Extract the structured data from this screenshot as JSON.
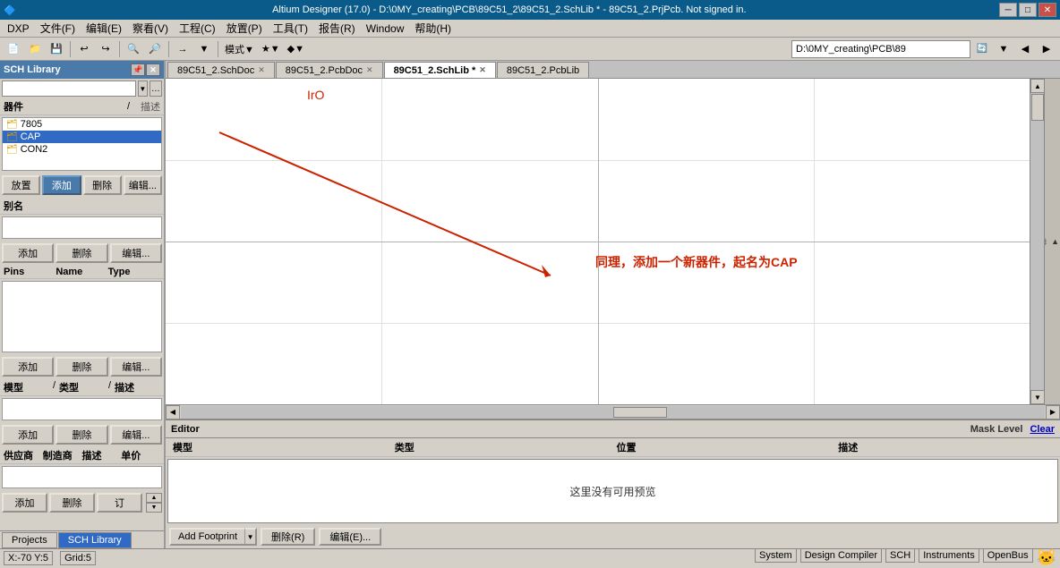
{
  "titlebar": {
    "title": "Altium Designer (17.0) - D:\\0MY_creating\\PCB\\89C51_2\\89C51_2.SchLib * - 89C51_2.PrjPcb. Not signed in.",
    "min_label": "─",
    "max_label": "□",
    "close_label": "✕"
  },
  "menubar": {
    "items": [
      "DXP",
      "文件(F)",
      "编辑(E)",
      "察看(V)",
      "工程(C)",
      "放置(P)",
      "工具(T)",
      "报告(R)",
      "Window",
      "帮助(H)"
    ]
  },
  "toolbar": {
    "path": "D:\\0MY_creating\\PCB\\89",
    "items": [
      "📄",
      "📂",
      "💾",
      "|",
      "↩",
      "↪",
      "|",
      "🔍",
      "🔍+",
      "|",
      "→",
      "▼",
      "|",
      "模式▼",
      "★▼",
      "◆▼"
    ]
  },
  "tabs": [
    {
      "id": "tab1",
      "label": "89C51_2.SchDoc",
      "active": false,
      "closable": true
    },
    {
      "id": "tab2",
      "label": "89C51_2.PcbDoc",
      "active": false,
      "closable": true
    },
    {
      "id": "tab3",
      "label": "89C51_2.SchLib *",
      "active": true,
      "closable": true
    },
    {
      "id": "tab4",
      "label": "89C51_2.PcbLib",
      "active": false,
      "closable": false
    }
  ],
  "left_panel": {
    "title": "SCH Library",
    "search_placeholder": "",
    "components_header": {
      "label": "器件",
      "desc": "描述"
    },
    "components": [
      {
        "name": "7805",
        "desc": ""
      },
      {
        "name": "CAP",
        "desc": ""
      },
      {
        "name": "CON2",
        "desc": ""
      }
    ],
    "selected_component": "CAP",
    "buttons1": [
      "放置",
      "添加",
      "删除",
      "编辑..."
    ],
    "alias_label": "别名",
    "alias_buttons": [
      "添加",
      "删除",
      "编辑..."
    ],
    "pins_header": {
      "pins": "Pins",
      "name": "Name",
      "type": "Type"
    },
    "pins_buttons": [
      "添加",
      "删除",
      "编辑..."
    ],
    "model_header": {
      "label": "模型",
      "type": "类型",
      "desc": "描述"
    },
    "model_buttons": [
      "添加",
      "删除",
      "编辑..."
    ],
    "supplier_header": {
      "supplier": "供应商",
      "mfr": "制造商",
      "desc": "描述",
      "unit": "单价"
    },
    "supplier_buttons": [
      "添加",
      "删除",
      "订"
    ],
    "supplier_spin_up": "▲",
    "supplier_spin_down": "▼"
  },
  "editor_panel": {
    "title": "Editor",
    "mask_level": "Mask Level",
    "clear": "Clear",
    "cols": [
      "模型",
      "类型",
      "位置",
      "描述"
    ],
    "no_preview": "这里没有可用预览",
    "footer_buttons": [
      "Add Footprint",
      "删除(R)",
      "编辑(E)..."
    ]
  },
  "bottom_tabs": [
    {
      "label": "Projects",
      "active": false
    },
    {
      "label": "SCH Library",
      "active": true
    }
  ],
  "statusbar": {
    "left": [
      "X:-70  Y:5",
      "Grid:5"
    ],
    "right": [
      "System",
      "Design Compiler",
      "SCH",
      "Instruments",
      "OpenBus"
    ]
  },
  "annotation": {
    "text": "同理，添加一个新器件，起名为CAP",
    "iro_text": "IrO"
  },
  "right_side_btns": [
    "▲",
    "排",
    "序"
  ]
}
